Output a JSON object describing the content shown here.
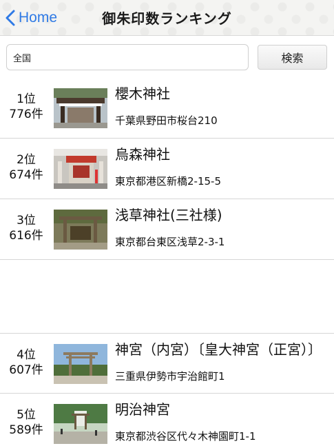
{
  "nav": {
    "back_label": "Home",
    "title": "御朱印数ランキング",
    "accent_color": "#2f7ae5"
  },
  "search": {
    "value": "全国",
    "button_label": "検索"
  },
  "ranking": [
    {
      "rank": "1位",
      "count": "776件",
      "name": "櫻木神社",
      "address": "千葉県野田市桜台210",
      "thumbnail": "shrine-gate-photo"
    },
    {
      "rank": "2位",
      "count": "674件",
      "name": "烏森神社",
      "address": "東京都港区新橋2-15-5",
      "thumbnail": "shrine-red-gate-photo"
    },
    {
      "rank": "3位",
      "count": "616件",
      "name": "浅草神社(三社様)",
      "address": "東京都台東区浅草2-3-1",
      "thumbnail": "shrine-torii-photo"
    },
    {
      "rank": "4位",
      "count": "607件",
      "name": "神宮（内宮）〔皇大神宮（正宮）〕",
      "address": "三重県伊勢市宇治館町1",
      "thumbnail": "ise-torii-photo"
    },
    {
      "rank": "5位",
      "count": "589件",
      "name": "明治神宮",
      "address": "東京都渋谷区代々木神園町1-1",
      "thumbnail": "meiji-forest-photo"
    }
  ]
}
